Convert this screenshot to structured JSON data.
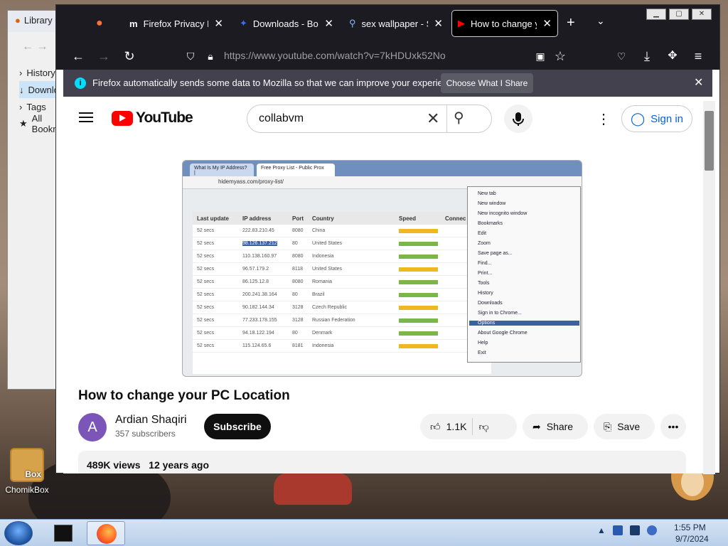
{
  "library": {
    "title": "Library",
    "items": [
      "History",
      "Downloads",
      "Tags",
      "All Bookmarks"
    ]
  },
  "desktop": {
    "icon_label": "ChomikBox",
    "icon_badge": "Box"
  },
  "tabs": [
    {
      "label": "",
      "icon": "firefox-icon"
    },
    {
      "label": "Firefox Privacy Notice",
      "icon": "mozilla-m-icon"
    },
    {
      "label": "Downloads - Bob",
      "icon": "bob-icon"
    },
    {
      "label": "sex wallpaper - Search",
      "icon": "search-icon"
    },
    {
      "label": "How to change your PC Location",
      "icon": "youtube-icon"
    }
  ],
  "nav": {
    "url": "https://www.youtube.com/watch?v=7kHDUxk52No"
  },
  "infobar": {
    "text": "Firefox automatically sends some data to Mozilla so that we can improve your experience.",
    "button": "Choose What I Share"
  },
  "youtube": {
    "logo_text": "YouTube",
    "search_value": "collabvm",
    "signin": "Sign in",
    "video_title": "How to change your PC Location",
    "channel_initial": "A",
    "channel_name": "Ardian Shaqiri",
    "subscribers": "357 subscribers",
    "subscribe": "Subscribe",
    "likes": "1.1K",
    "share": "Share",
    "save": "Save",
    "views": "489K views",
    "age": "12 years ago"
  },
  "video_frame": {
    "tab1": "What Is My IP Address? |",
    "tab2": "Free Proxy List - Public Prox",
    "address": "hidemyass.com/proxy-list/",
    "columns": [
      "Last update",
      "IP address",
      "Port",
      "Country",
      "Speed",
      "Connec"
    ],
    "rows": [
      [
        "52 secs",
        "222.83.210.45",
        "8080",
        "China"
      ],
      [
        "52 secs",
        "98.126.137.212",
        "80",
        "United States"
      ],
      [
        "52 secs",
        "110.138.160.97",
        "8080",
        "Indonesia"
      ],
      [
        "52 secs",
        "96.57.179.2",
        "8118",
        "United States"
      ],
      [
        "52 secs",
        "86.125.12.8",
        "8080",
        "Romania"
      ],
      [
        "52 secs",
        "200.241.38.164",
        "80",
        "Brazil"
      ],
      [
        "52 secs",
        "90.182.144.34",
        "3128",
        "Czech Republic"
      ],
      [
        "52 secs",
        "77.233.178.155",
        "3128",
        "Russian Federation"
      ],
      [
        "52 secs",
        "94.18.122.194",
        "80",
        "Denmark"
      ],
      [
        "52 secs",
        "115.124.65.6",
        "8181",
        "Indonesia"
      ]
    ],
    "menu": [
      "New tab",
      "New window",
      "New incognito window",
      "Bookmarks",
      "Edit",
      "Zoom",
      "Save page as...",
      "Find...",
      "Print...",
      "Tools",
      "History",
      "Downloads",
      "Sign in to Chrome...",
      "Options",
      "About Google Chrome",
      "Help",
      "Exit"
    ]
  },
  "taskbar": {
    "time": "1:55 PM",
    "date": "9/7/2024"
  },
  "colors": {
    "youtube_red": "#ff0000",
    "firefox_dark": "#1c1b22",
    "link_blue": "#065fd4"
  }
}
